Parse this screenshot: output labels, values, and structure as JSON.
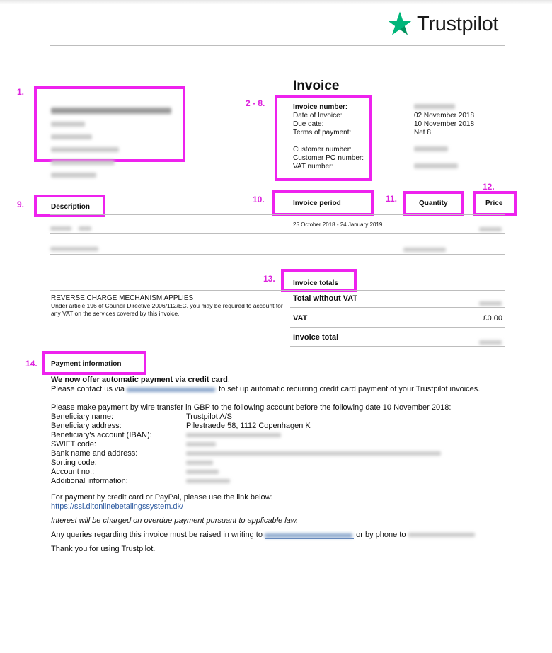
{
  "brand": {
    "logo_icon": "star-icon",
    "logo_text": "Trustpilot",
    "star_color": "#00b67a"
  },
  "annotation_color": "#ee22ee",
  "annotations": {
    "n1": "1.",
    "n2_8": "2 - 8.",
    "n9": "9.",
    "n10": "10.",
    "n11": "11.",
    "n12": "12.",
    "n13": "13.",
    "n14": "14."
  },
  "recipient": {
    "redacted": true
  },
  "invoice": {
    "title": "Invoice",
    "fields": [
      {
        "label": "Invoice number:",
        "value": "",
        "redacted": true
      },
      {
        "label": "Date of Invoice:",
        "value": "02 November 2018"
      },
      {
        "label": "Due date:",
        "value": "10 November 2018"
      },
      {
        "label": "Terms of payment:",
        "value": "Net 8"
      },
      {
        "label": "Customer number:",
        "value": "",
        "redacted": true
      },
      {
        "label": "Customer PO number:",
        "value": ""
      },
      {
        "label": "VAT number:",
        "value": "",
        "redacted": true
      }
    ]
  },
  "lines": {
    "headers": {
      "description": "Description",
      "period": "Invoice period",
      "quantity": "Quantity",
      "price": "Price"
    },
    "rows": [
      {
        "description": "",
        "period": "25 October 2018 - 24 January 2019",
        "quantity": "",
        "price": "",
        "redacted": true
      },
      {
        "description": "",
        "period": "",
        "quantity": "",
        "price": "",
        "redacted": true
      }
    ]
  },
  "reverse_charge": {
    "title": "REVERSE CHARGE MECHANISM APPLIES",
    "body": "Under article 196 of Council Directive 2006/112/EC, you may be required to account for any VAT on the services covered by this invoice."
  },
  "totals": {
    "header": "Invoice totals",
    "rows": [
      {
        "label": "Total without VAT",
        "value": "",
        "redacted": true
      },
      {
        "label": "VAT",
        "value": "£0.00"
      },
      {
        "label": "Invoice total",
        "value": "",
        "redacted": true
      }
    ]
  },
  "payment": {
    "header": "Payment information",
    "auto_bold": "We now offer automatic payment via credit card",
    "auto_period": ".",
    "contact_pre": "Please contact us via",
    "contact_post": "to set up automatic recurring credit card payment of your Trustpilot invoices.",
    "wire_intro": "Please make payment by wire transfer in GBP to the following account before the following date 10 November 2018:",
    "details": [
      {
        "label": "Beneficiary name:",
        "value": "Trustpilot A/S"
      },
      {
        "label": "Beneficiary address:",
        "value": "Pilestraede 58, 1112 Copenhagen K"
      },
      {
        "label": "Beneficiary's account (IBAN):",
        "value": "",
        "redacted": true
      },
      {
        "label": "SWIFT code:",
        "value": "",
        "redacted": true
      },
      {
        "label": "Bank name and address:",
        "value": "",
        "redacted": true
      },
      {
        "label": "Sorting code:",
        "value": "",
        "redacted": true
      },
      {
        "label": "Account no.:",
        "value": "",
        "redacted": true
      },
      {
        "label": "Additional information:",
        "value": "",
        "redacted": true
      }
    ],
    "card_paypal": "For payment by credit card or PayPal, please use the link below:",
    "card_link": "https://ssl.ditonlinebetalingssystem.dk/",
    "interest": "Interest will be charged on overdue payment pursuant to applicable law.",
    "queries_pre": "Any queries regarding this invoice must be raised in writing to",
    "queries_mid": "or by phone to",
    "thanks": "Thank you for using Trustpilot."
  }
}
